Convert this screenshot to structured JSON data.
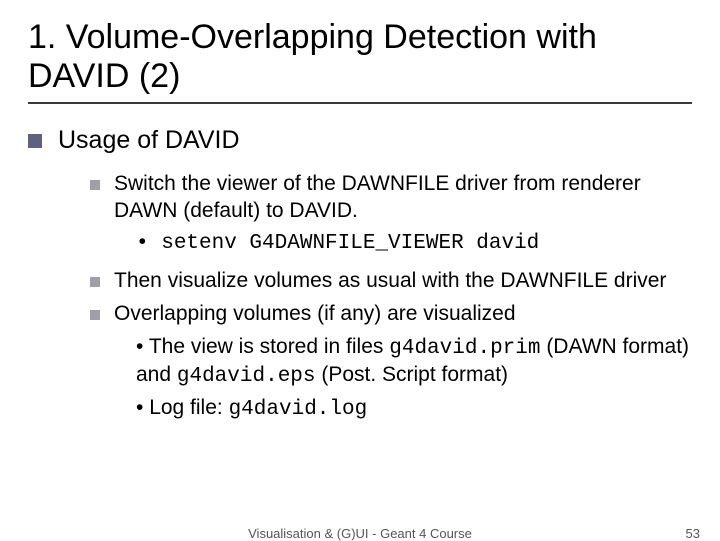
{
  "title": "1. Volume-Overlapping Detection with DAVID (2)",
  "lvl1": {
    "text": "Usage of DAVID"
  },
  "b1": {
    "text": "Switch the viewer of the DAWNFILE driver from renderer DAWN (default) to DAVID."
  },
  "b1cmd": {
    "text": "setenv G4DAWNFILE_VIEWER david"
  },
  "b2": {
    "text": "Then visualize volumes as usual with the DAWNFILE driver"
  },
  "b3": {
    "text": "Overlapping volumes (if any) are visualized"
  },
  "b3a_pre": "The view is stored in files ",
  "b3a_code1": "g4david.prim",
  "b3a_mid1": " (DAWN format) and ",
  "b3a_code2": "g4david.eps",
  "b3a_mid2": " (Post. Script format)",
  "b3b_pre": "Log file: ",
  "b3b_code": "g4david.log",
  "footer": {
    "center": "Visualisation & (G)UI - Geant 4 Course",
    "page": "53"
  }
}
